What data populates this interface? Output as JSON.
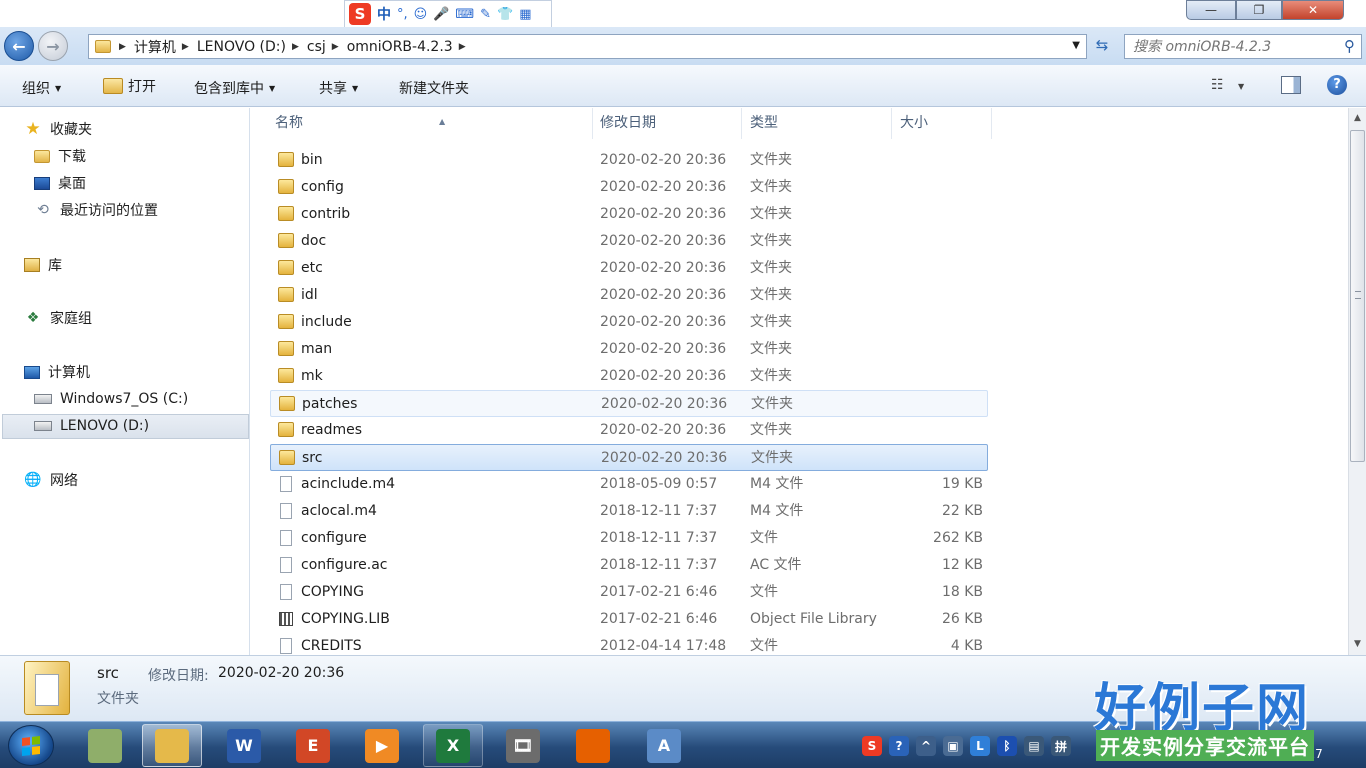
{
  "ime": {
    "logo": "S",
    "mode": "中",
    "icons": [
      "punctuation-icon",
      "emoji-icon",
      "voice-icon",
      "keyboard-icon",
      "tools-icon",
      "skin-icon",
      "grid-icon"
    ]
  },
  "caption": {
    "minimize": "—",
    "maximize": "❐",
    "close": "✕"
  },
  "address": {
    "breadcrumbs": [
      "计算机",
      "LENOVO (D:)",
      "csj",
      "omniORB-4.2.3"
    ],
    "search_placeholder": "搜索 omniORB-4.2.3"
  },
  "toolbar": {
    "organize": "组织",
    "open": "打开",
    "include_library": "包含到库中",
    "share": "共享",
    "new_folder": "新建文件夹"
  },
  "nav": {
    "favorites": "收藏夹",
    "downloads": "下载",
    "desktop": "桌面",
    "recent": "最近访问的位置",
    "libraries": "库",
    "homegroup": "家庭组",
    "computer": "计算机",
    "drive_c": "Windows7_OS (C:)",
    "drive_d": "LENOVO (D:)",
    "network": "网络"
  },
  "columns": {
    "name": "名称",
    "modified": "修改日期",
    "type": "类型",
    "size": "大小"
  },
  "files": [
    {
      "name": "bin",
      "date": "2020-02-20 20:36",
      "type": "文件夹",
      "size": "",
      "kind": "folder"
    },
    {
      "name": "config",
      "date": "2020-02-20 20:36",
      "type": "文件夹",
      "size": "",
      "kind": "folder"
    },
    {
      "name": "contrib",
      "date": "2020-02-20 20:36",
      "type": "文件夹",
      "size": "",
      "kind": "folder"
    },
    {
      "name": "doc",
      "date": "2020-02-20 20:36",
      "type": "文件夹",
      "size": "",
      "kind": "folder"
    },
    {
      "name": "etc",
      "date": "2020-02-20 20:36",
      "type": "文件夹",
      "size": "",
      "kind": "folder"
    },
    {
      "name": "idl",
      "date": "2020-02-20 20:36",
      "type": "文件夹",
      "size": "",
      "kind": "folder"
    },
    {
      "name": "include",
      "date": "2020-02-20 20:36",
      "type": "文件夹",
      "size": "",
      "kind": "folder"
    },
    {
      "name": "man",
      "date": "2020-02-20 20:36",
      "type": "文件夹",
      "size": "",
      "kind": "folder"
    },
    {
      "name": "mk",
      "date": "2020-02-20 20:36",
      "type": "文件夹",
      "size": "",
      "kind": "folder"
    },
    {
      "name": "patches",
      "date": "2020-02-20 20:36",
      "type": "文件夹",
      "size": "",
      "kind": "folder",
      "state": "hover"
    },
    {
      "name": "readmes",
      "date": "2020-02-20 20:36",
      "type": "文件夹",
      "size": "",
      "kind": "folder"
    },
    {
      "name": "src",
      "date": "2020-02-20 20:36",
      "type": "文件夹",
      "size": "",
      "kind": "folder",
      "state": "selected"
    },
    {
      "name": "acinclude.m4",
      "date": "2018-05-09 0:57",
      "type": "M4 文件",
      "size": "19 KB",
      "kind": "file"
    },
    {
      "name": "aclocal.m4",
      "date": "2018-12-11 7:37",
      "type": "M4 文件",
      "size": "22 KB",
      "kind": "file"
    },
    {
      "name": "configure",
      "date": "2018-12-11 7:37",
      "type": "文件",
      "size": "262 KB",
      "kind": "file"
    },
    {
      "name": "configure.ac",
      "date": "2018-12-11 7:37",
      "type": "AC 文件",
      "size": "12 KB",
      "kind": "file"
    },
    {
      "name": "COPYING",
      "date": "2017-02-21 6:46",
      "type": "文件",
      "size": "18 KB",
      "kind": "file"
    },
    {
      "name": "COPYING.LIB",
      "date": "2017-02-21 6:46",
      "type": "Object File Library",
      "size": "26 KB",
      "kind": "library"
    },
    {
      "name": "CREDITS",
      "date": "2012-04-14 17:48",
      "type": "文件",
      "size": "4 KB",
      "kind": "file"
    }
  ],
  "details": {
    "name": "src",
    "modified_label": "修改日期:",
    "modified_value": "2020-02-20 20:36",
    "type": "文件夹"
  },
  "taskbar": {
    "apps": [
      {
        "id": "taskbar-app-notes",
        "label": "",
        "color": "#8fae6a"
      },
      {
        "id": "taskbar-app-explorer",
        "label": "",
        "color": "#e5b94a",
        "state": "active"
      },
      {
        "id": "taskbar-app-word",
        "label": "W",
        "color": "#2b5aa8"
      },
      {
        "id": "taskbar-app-powerpoint-viewer",
        "label": "E",
        "color": "#d24726"
      },
      {
        "id": "taskbar-app-media-player",
        "label": "▶",
        "color": "#f08a24"
      },
      {
        "id": "taskbar-app-excel",
        "label": "X",
        "color": "#1f7a3d",
        "state": "open"
      },
      {
        "id": "taskbar-app-video",
        "label": "🎞",
        "color": "#6c6c6c"
      },
      {
        "id": "taskbar-app-firefox",
        "label": "",
        "color": "#e66000"
      },
      {
        "id": "taskbar-app-document",
        "label": "A",
        "color": "#5b8bc7"
      }
    ],
    "tray": [
      {
        "id": "sogou-tray-icon",
        "label": "S",
        "color": "#ee3a24"
      },
      {
        "id": "help-tray-icon",
        "label": "?",
        "color": "#2a63b8"
      },
      {
        "id": "arrow-tray-icon",
        "label": "^",
        "color": "#3d5f8a"
      },
      {
        "id": "device-tray-icon",
        "label": "▣",
        "color": "#4a6b93"
      },
      {
        "id": "l-tray-icon",
        "label": "L",
        "color": "#2f7fd8"
      },
      {
        "id": "bluetooth-tray-icon",
        "label": "ᛒ",
        "color": "#1c4fb0"
      },
      {
        "id": "network-tray-icon",
        "label": "▤",
        "color": "#3a5878"
      },
      {
        "id": "ime-tray-icon",
        "label": "拼",
        "color": "#3a5878"
      }
    ],
    "clock": "2020-10-17"
  },
  "watermark": {
    "title": "好例子网",
    "subtitle": "开发实例分享交流平台"
  }
}
